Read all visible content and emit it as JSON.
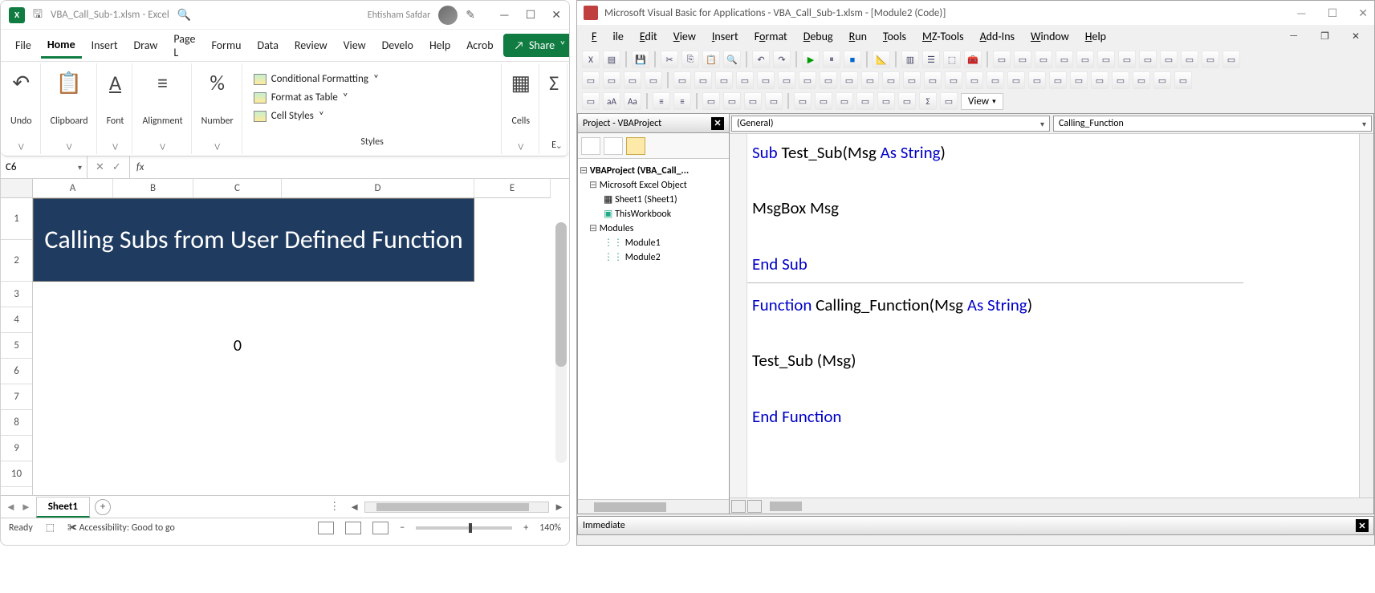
{
  "excel": {
    "filename": "VBA_Call_Sub-1.xlsm - Excel",
    "user": "Ehtisham Safdar",
    "menubar": {
      "file": "File",
      "home": "Home",
      "insert": "Insert",
      "draw": "Draw",
      "page": "Page L",
      "formu": "Formu",
      "data": "Data",
      "review": "Review",
      "view": "View",
      "devel": "Develo",
      "help": "Help",
      "acrob": "Acrob"
    },
    "share": "Share",
    "ribbon": {
      "undo": "Undo",
      "clipboard": "Clipboard",
      "font": "Font",
      "alignment": "Alignment",
      "number": "Number",
      "cond": "Conditional Formatting",
      "fat": "Format as Table",
      "cellstyles": "Cell Styles",
      "styles": "Styles",
      "cells": "Cells",
      "edit": "E"
    },
    "namebox": "C6",
    "fx": "fx",
    "cols": {
      "A": "A",
      "B": "B",
      "C": "C",
      "D": "D",
      "E": "E"
    },
    "rows": [
      "1",
      "2",
      "3",
      "4",
      "5",
      "6",
      "7",
      "8",
      "9",
      "10"
    ],
    "banner": "Calling Subs from User Defined Function",
    "c5": "0",
    "sheet": "Sheet1",
    "status": {
      "ready": "Ready",
      "access": "Accessibility: Good to go",
      "zoom": "140%"
    }
  },
  "vba": {
    "title": "Microsoft Visual Basic for Applications - VBA_Call_Sub-1.xlsm - [Module2 (Code)]",
    "menu": {
      "file": "File",
      "edit": "Edit",
      "view": "View",
      "insert": "Insert",
      "format": "Format",
      "debug": "Debug",
      "run": "Run",
      "tools": "Tools",
      "mz": "MZ-Tools",
      "addins": "Add-Ins",
      "window": "Window",
      "help": "Help"
    },
    "viewbtn": "View",
    "project": {
      "title": "Project - VBAProject",
      "root": "VBAProject (VBA_Call_...",
      "meo": "Microsoft Excel Object",
      "sheet1": "Sheet1 (Sheet1)",
      "thiswb": "ThisWorkbook",
      "modules": "Modules",
      "mod1": "Module1",
      "mod2": "Module2"
    },
    "dd": {
      "left": "(General)",
      "right": "Calling_Function"
    },
    "code": {
      "l1a": "Sub",
      "l1b": " Test_Sub(Msg ",
      "l1c": "As String",
      "l1d": ")",
      "l2": "    MsgBox Msg",
      "l3": "End Sub",
      "l4a": "Function",
      "l4b": " Calling_Function(Msg ",
      "l4c": "As String",
      "l4d": ")",
      "l5": " Test_Sub (Msg)",
      "l6": "End Function"
    },
    "immediate": "Immediate"
  }
}
